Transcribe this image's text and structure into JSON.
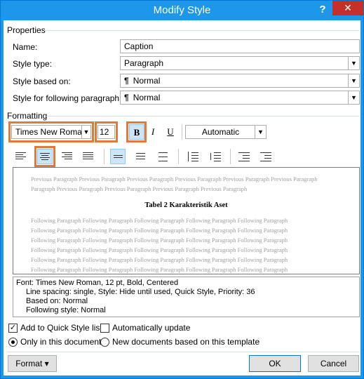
{
  "title": "Modify Style",
  "window": {
    "help": "?",
    "close": "✕"
  },
  "properties": {
    "section": "Properties",
    "name_label": "Name:",
    "name_value": "Caption",
    "type_label": "Style type:",
    "type_value": "Paragraph",
    "based_label": "Style based on:",
    "based_value": "Normal",
    "following_label": "Style for following paragraph:",
    "following_value": "Normal"
  },
  "formatting": {
    "section": "Formatting",
    "font": "Times New Roman",
    "size": "12",
    "bold": "B",
    "italic": "I",
    "underline": "U",
    "color": "Automatic",
    "accent_highlight": "#e07b39"
  },
  "preview": {
    "previous": [
      "Previous Paragraph Previous Paragraph Previous Paragraph Previous Paragraph Previous Paragraph Previous Paragraph",
      "Paragraph Previous Paragraph Previous Paragraph Previous Paragraph Previous Paragraph"
    ],
    "sample": "Tabel 2 Karakteristik Aset",
    "following": [
      "Following Paragraph Following Paragraph Following Paragraph Following Paragraph Following Paragraph",
      "Following Paragraph Following Paragraph Following Paragraph Following Paragraph Following Paragraph",
      "Following Paragraph Following Paragraph Following Paragraph Following Paragraph Following Paragraph",
      "Following Paragraph Following Paragraph Following Paragraph Following Paragraph Following Paragraph",
      "Following Paragraph Following Paragraph Following Paragraph Following Paragraph Following Paragraph",
      "Following Paragraph Following Paragraph Following Paragraph Following Paragraph Following Paragraph"
    ]
  },
  "description": {
    "line1": "Font: Times New Roman, 12 pt, Bold, Centered",
    "line2": "Line spacing:  single, Style: Hide until used, Quick Style, Priority: 36",
    "line3": "Based on: Normal",
    "line4": "Following style: Normal"
  },
  "options": {
    "quick_style": "Add to Quick Style list",
    "auto_update": "Automatically update",
    "only_doc": "Only in this document",
    "new_docs": "New documents based on this template"
  },
  "buttons": {
    "format": "Format",
    "format_arrow": "▾",
    "ok": "OK",
    "cancel": "Cancel"
  },
  "icons": {
    "check": "✓",
    "para": "¶",
    "dropdown": "▼"
  }
}
